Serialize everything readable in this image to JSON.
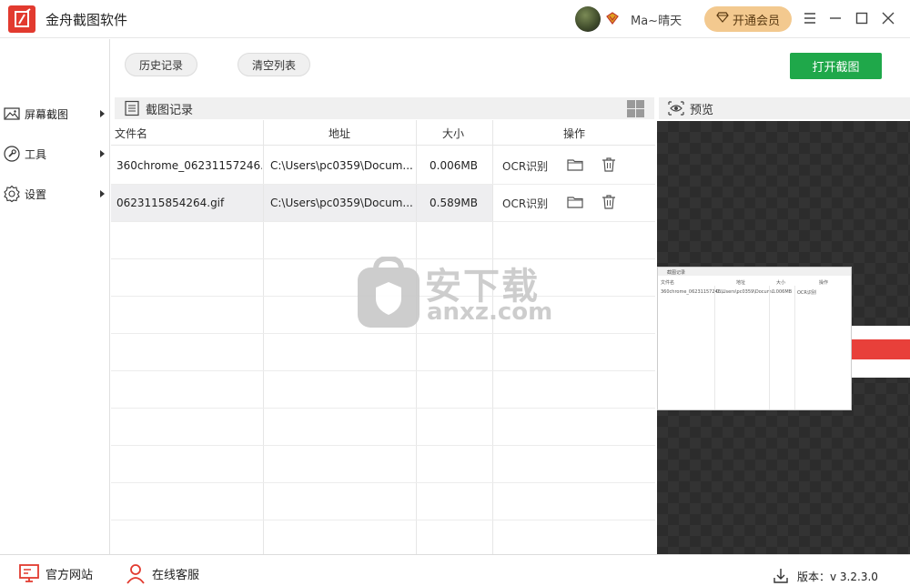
{
  "app": {
    "title": "金舟截图软件"
  },
  "user": {
    "name": "Ma~晴天",
    "vip_button": "开通会员"
  },
  "sidebar": {
    "items": [
      {
        "label": "屏幕截图",
        "icon": "image-icon"
      },
      {
        "label": "工具",
        "icon": "wrench-icon"
      },
      {
        "label": "设置",
        "icon": "gear-icon"
      }
    ]
  },
  "toolbar": {
    "history": "历史记录",
    "clear": "清空列表",
    "open": "打开截图"
  },
  "records": {
    "title": "截图记录",
    "columns": [
      "文件名",
      "地址",
      "大小",
      "操作"
    ],
    "rows": [
      {
        "name": "360chrome_06231157246...",
        "path": "C:\\Users\\pc0359\\Docum...",
        "size": "0.006MB",
        "ocr": "OCR识别"
      },
      {
        "name": "0623115854264.gif",
        "path": "C:\\Users\\pc0359\\Docum...",
        "size": "0.589MB",
        "ocr": "OCR识别"
      }
    ]
  },
  "preview": {
    "title": "预览"
  },
  "watermark": {
    "text": "安下载",
    "sub": "anxz.com"
  },
  "status": {
    "website": "官方网站",
    "support": "在线客服",
    "version": "版本：v 3.2.3.0"
  },
  "colors": {
    "primary": "#1fa84a",
    "logo": "#e23a2f",
    "vip": "#f3c98f"
  }
}
